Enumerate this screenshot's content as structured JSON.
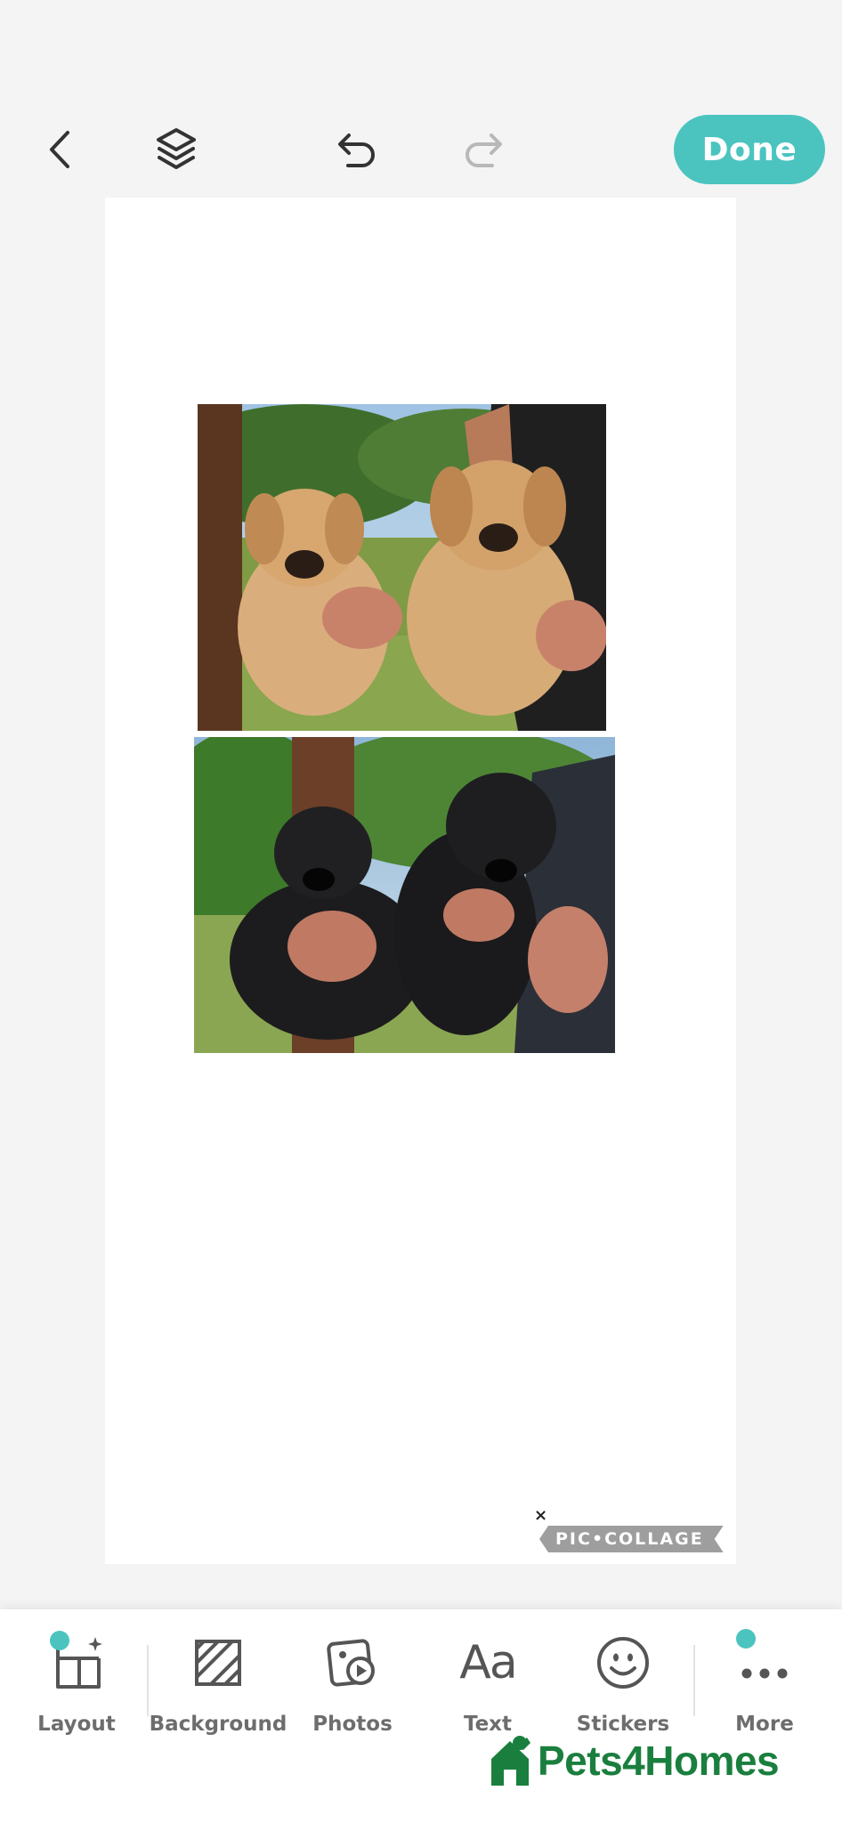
{
  "toolbar": {
    "back_icon": "chevron-left-icon",
    "layers_icon": "layers-icon",
    "undo_icon": "undo-icon",
    "redo_icon": "redo-icon",
    "done_label": "Done"
  },
  "canvas": {
    "photos": [
      {
        "subject": "two yellow labrador puppies held up outdoors"
      },
      {
        "subject": "two black labrador puppies held up outdoors"
      }
    ],
    "watermark": {
      "close_symbol": "×",
      "label": "PIC•COLLAGE"
    }
  },
  "tools": [
    {
      "label": "Layout",
      "icon": "layout-grid-icon",
      "has_dot": true
    },
    {
      "label": "Background",
      "icon": "background-pattern-icon",
      "has_dot": false
    },
    {
      "label": "Photos",
      "icon": "photos-icon",
      "has_dot": false
    },
    {
      "label": "Text",
      "icon": "text-aa-icon",
      "icon_text": "Aa",
      "has_dot": false
    },
    {
      "label": "Stickers",
      "icon": "smiley-sticker-icon",
      "has_dot": false
    },
    {
      "label": "More",
      "icon": "more-dots-icon",
      "has_dot": true
    }
  ],
  "brand": {
    "name": "Pets4Homes"
  },
  "colors": {
    "accent": "#4bc4c0",
    "brand_green": "#1a7f3e",
    "background": "#f4f4f4"
  }
}
